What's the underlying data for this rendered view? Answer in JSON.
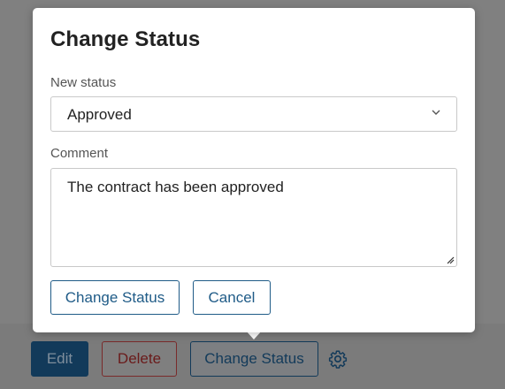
{
  "dialog": {
    "title": "Change Status",
    "status_label": "New status",
    "status_value": "Approved",
    "comment_label": "Comment",
    "comment_value": "The contract has been approved",
    "confirm_label": "Change Status",
    "cancel_label": "Cancel"
  },
  "toolbar": {
    "edit_label": "Edit",
    "delete_label": "Delete",
    "change_status_label": "Change Status",
    "settings_icon": "gear-icon"
  },
  "colors": {
    "accent": "#1f5b87",
    "primary_button": "#123a5a",
    "danger": "#7a2a2a",
    "overlay": "#808080"
  }
}
